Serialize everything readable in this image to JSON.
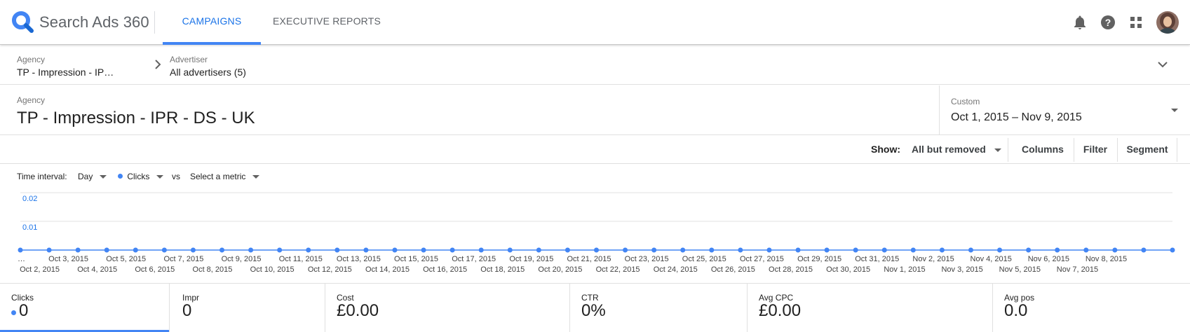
{
  "app": {
    "title": "Search Ads 360",
    "brand_color": "#4285f4"
  },
  "nav": {
    "tabs": [
      {
        "label": "CAMPAIGNS",
        "active": true
      },
      {
        "label": "EXECUTIVE REPORTS",
        "active": false
      }
    ]
  },
  "top_icons": [
    "bell-icon",
    "help-icon",
    "apps-grid-icon",
    "avatar"
  ],
  "breadcrumb": {
    "agency_label": "Agency",
    "agency_value": "TP - Impression - IP…",
    "advertiser_label": "Advertiser",
    "advertiser_value": "All advertisers (5)"
  },
  "header": {
    "entity_label": "Agency",
    "entity_name": "TP - Impression - IPR - DS - UK",
    "date_label": "Custom",
    "date_range": "Oct 1, 2015 – Nov 9, 2015"
  },
  "toolbar": {
    "show_label": "Show:",
    "show_value": "All but removed",
    "columns": "Columns",
    "filter": "Filter",
    "segment": "Segment"
  },
  "chart_controls": {
    "interval_label": "Time interval:",
    "interval_value": "Day",
    "metric": "Clicks",
    "vs": "vs",
    "compare": "Select a metric"
  },
  "chart_data": {
    "type": "line",
    "series": [
      {
        "name": "Clicks",
        "values": [
          0,
          0,
          0,
          0,
          0,
          0,
          0,
          0,
          0,
          0,
          0,
          0,
          0,
          0,
          0,
          0,
          0,
          0,
          0,
          0,
          0,
          0,
          0,
          0,
          0,
          0,
          0,
          0,
          0,
          0,
          0,
          0,
          0,
          0,
          0,
          0,
          0,
          0,
          0,
          0,
          0
        ]
      }
    ],
    "x": [
      "…",
      "Oct 2, 2015",
      "Oct 3, 2015",
      "Oct 4, 2015",
      "Oct 5, 2015",
      "Oct 6, 2015",
      "Oct 7, 2015",
      "Oct 8, 2015",
      "Oct 9, 2015",
      "Oct 10, 2015",
      "Oct 11, 2015",
      "Oct 12, 2015",
      "Oct 13, 2015",
      "Oct 14, 2015",
      "Oct 15, 2015",
      "Oct 16, 2015",
      "Oct 17, 2015",
      "Oct 18, 2015",
      "Oct 19, 2015",
      "Oct 20, 2015",
      "Oct 21, 2015",
      "Oct 22, 2015",
      "Oct 23, 2015",
      "Oct 24, 2015",
      "Oct 25, 2015",
      "Oct 26, 2015",
      "Oct 27, 2015",
      "Oct 28, 2015",
      "Oct 29, 2015",
      "Oct 30, 2015",
      "Oct 31, 2015",
      "Nov 1, 2015",
      "Nov 2, 2015",
      "Nov 3, 2015",
      "Nov 4, 2015",
      "Nov 5, 2015",
      "Nov 6, 2015",
      "Nov 7, 2015",
      "Nov 8, 2015",
      "",
      ""
    ],
    "y_ticks": [
      "0.02",
      "0.01"
    ],
    "ylim": [
      0,
      0.02
    ],
    "grid": true,
    "color": "#4285f4"
  },
  "scorecards": [
    {
      "label": "Clicks",
      "value": "0",
      "active": true
    },
    {
      "label": "Impr",
      "value": "0",
      "active": false
    },
    {
      "label": "Cost",
      "value": "£0.00",
      "active": false
    },
    {
      "label": "CTR",
      "value": "0%",
      "active": false
    },
    {
      "label": "Avg CPC",
      "value": "£0.00",
      "active": false
    },
    {
      "label": "Avg pos",
      "value": "0.0",
      "active": false
    }
  ]
}
